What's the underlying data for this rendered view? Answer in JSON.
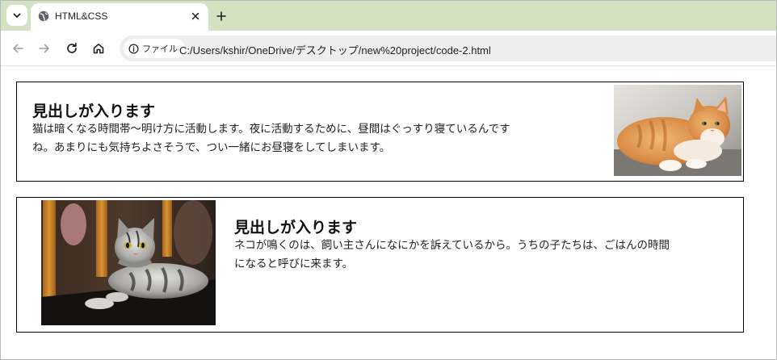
{
  "browser": {
    "tab": {
      "title": "HTML&CSS",
      "favicon": "globe-icon"
    },
    "tab_menu_icon": "chevron-down-icon",
    "close_icon": "close-icon",
    "new_tab_icon": "plus-icon",
    "nav": {
      "back_icon": "arrow-left-icon",
      "forward_icon": "arrow-right-icon",
      "reload_icon": "reload-icon",
      "home_icon": "home-icon"
    },
    "address": {
      "chip_icon": "info-icon",
      "chip_label": "ファイル",
      "url": "C:/Users/kshir/OneDrive/デスクトップ/new%20project/code-2.html"
    },
    "colors": {
      "tab_strip": "#d3e3c2",
      "omnibox": "#eeeeee"
    }
  },
  "page": {
    "cards": [
      {
        "heading": "見出しが入ります",
        "body_line1": "猫は暗くなる時間帯〜明け方に活動します。夜に活動するために、昼間はぐっすり寝ているんです",
        "body_line2": "ね。あまりにも気持ちよさそうで、つい一緒にお昼寝をしてしまいます。",
        "image": "orange-cat-photo",
        "image_position": "right"
      },
      {
        "heading": "見出しが入ります",
        "body_line1": "ネコが鳴くのは、飼い主さんになにかを訴えているから。うちの子たちは、ごはんの時間",
        "body_line2": "になると呼びに来ます。",
        "image": "tabby-cat-photo",
        "image_position": "left"
      }
    ],
    "colors": {
      "card_border": "#000000",
      "text": "#222222"
    }
  }
}
